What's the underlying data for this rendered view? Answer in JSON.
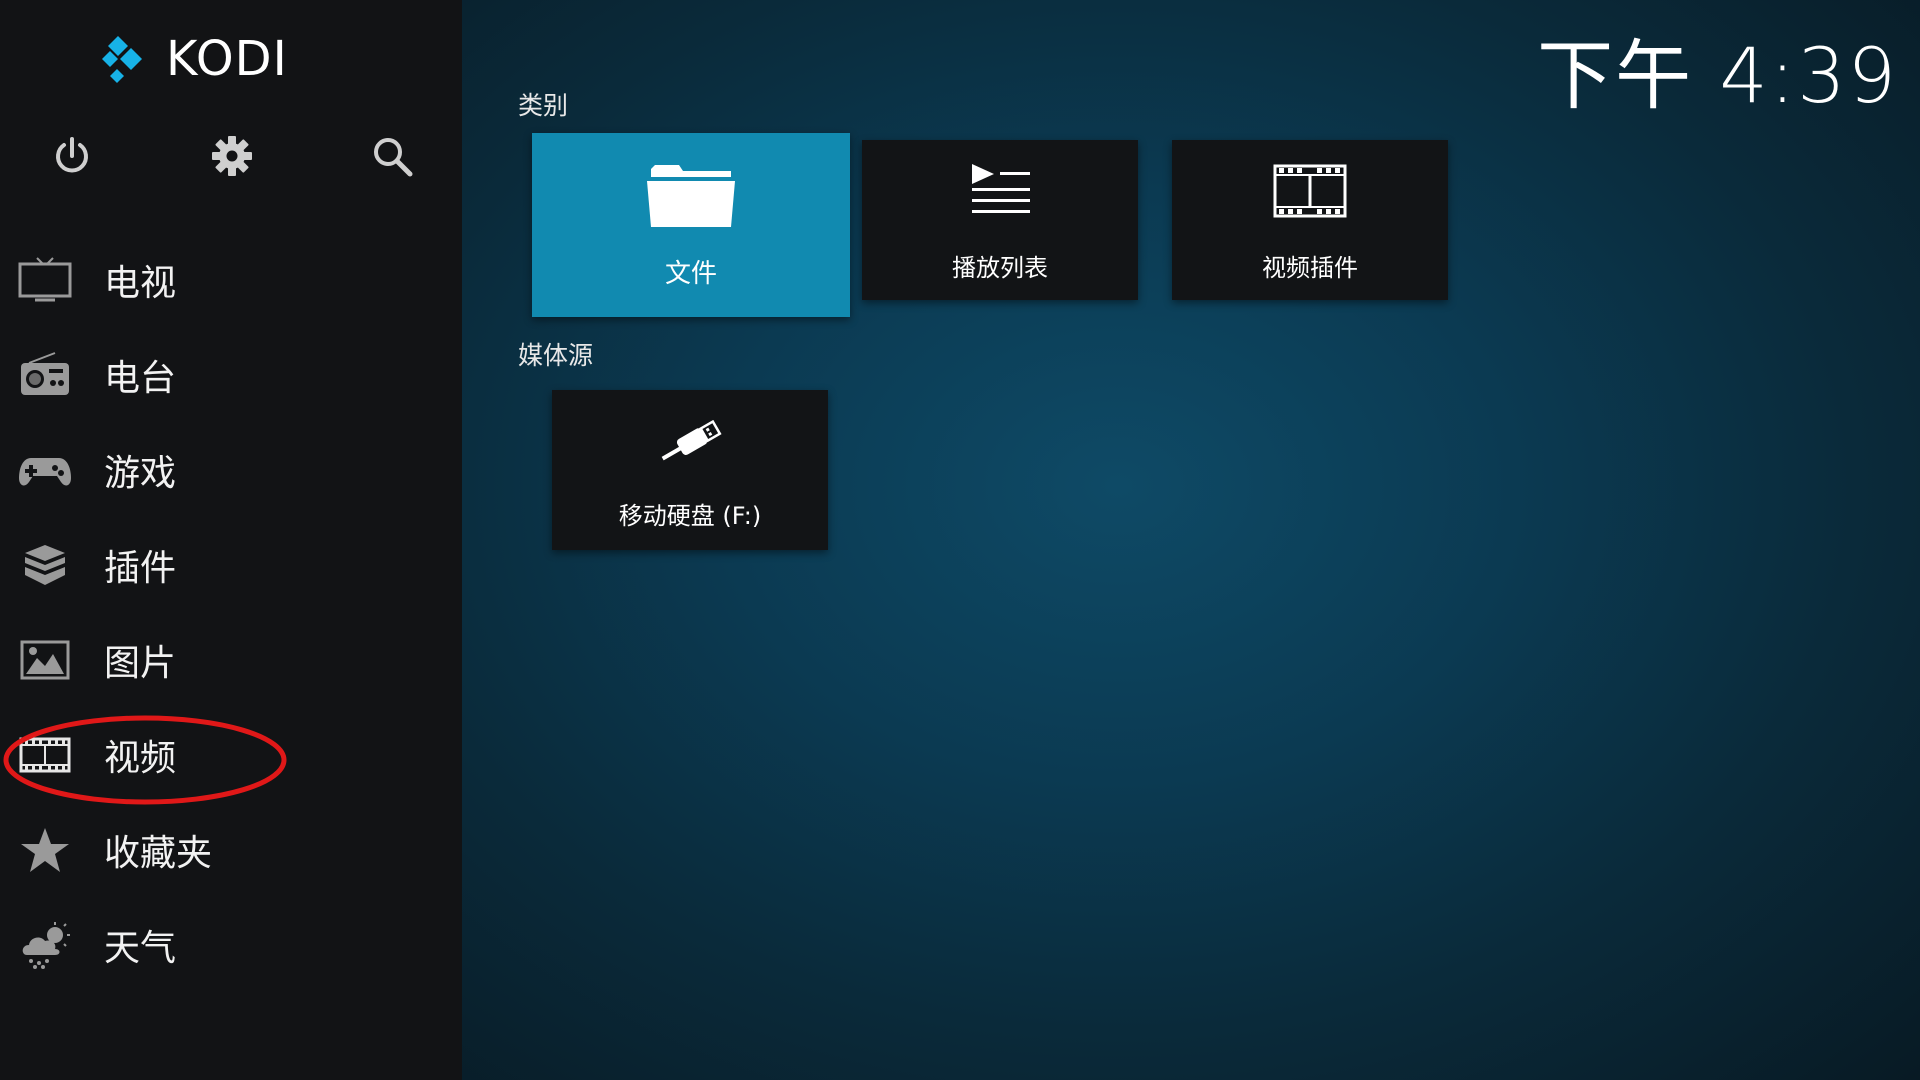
{
  "app": {
    "logo_text": "KODI"
  },
  "clock": "下午 4:39",
  "top_icons": [
    {
      "name": "power-icon"
    },
    {
      "name": "gear-icon"
    },
    {
      "name": "search-icon"
    }
  ],
  "sidebar": {
    "items": [
      {
        "label": "电视",
        "icon": "tv-icon"
      },
      {
        "label": "电台",
        "icon": "radio-icon"
      },
      {
        "label": "游戏",
        "icon": "gamepad-icon"
      },
      {
        "label": "插件",
        "icon": "addons-box-icon"
      },
      {
        "label": "图片",
        "icon": "picture-icon"
      },
      {
        "label": "视频",
        "icon": "film-icon",
        "highlighted": true
      },
      {
        "label": "收藏夹",
        "icon": "star-icon"
      },
      {
        "label": "天气",
        "icon": "weather-icon"
      }
    ]
  },
  "main": {
    "categories_label": "类别",
    "categories": [
      {
        "label": "文件",
        "icon": "folder-icon",
        "focused": true
      },
      {
        "label": "播放列表",
        "icon": "playlist-icon"
      },
      {
        "label": "视频插件",
        "icon": "film-icon"
      }
    ],
    "sources_label": "媒体源",
    "sources": [
      {
        "label": "移动硬盘 (F:)",
        "icon": "usb-icon"
      }
    ]
  },
  "colors": {
    "sidebar_bg": "#121315",
    "tile_bg": "#121416",
    "focused_tile": "#118ab0",
    "kodi_blue": "#17b2e7",
    "highlight_ring": "#e01818"
  }
}
